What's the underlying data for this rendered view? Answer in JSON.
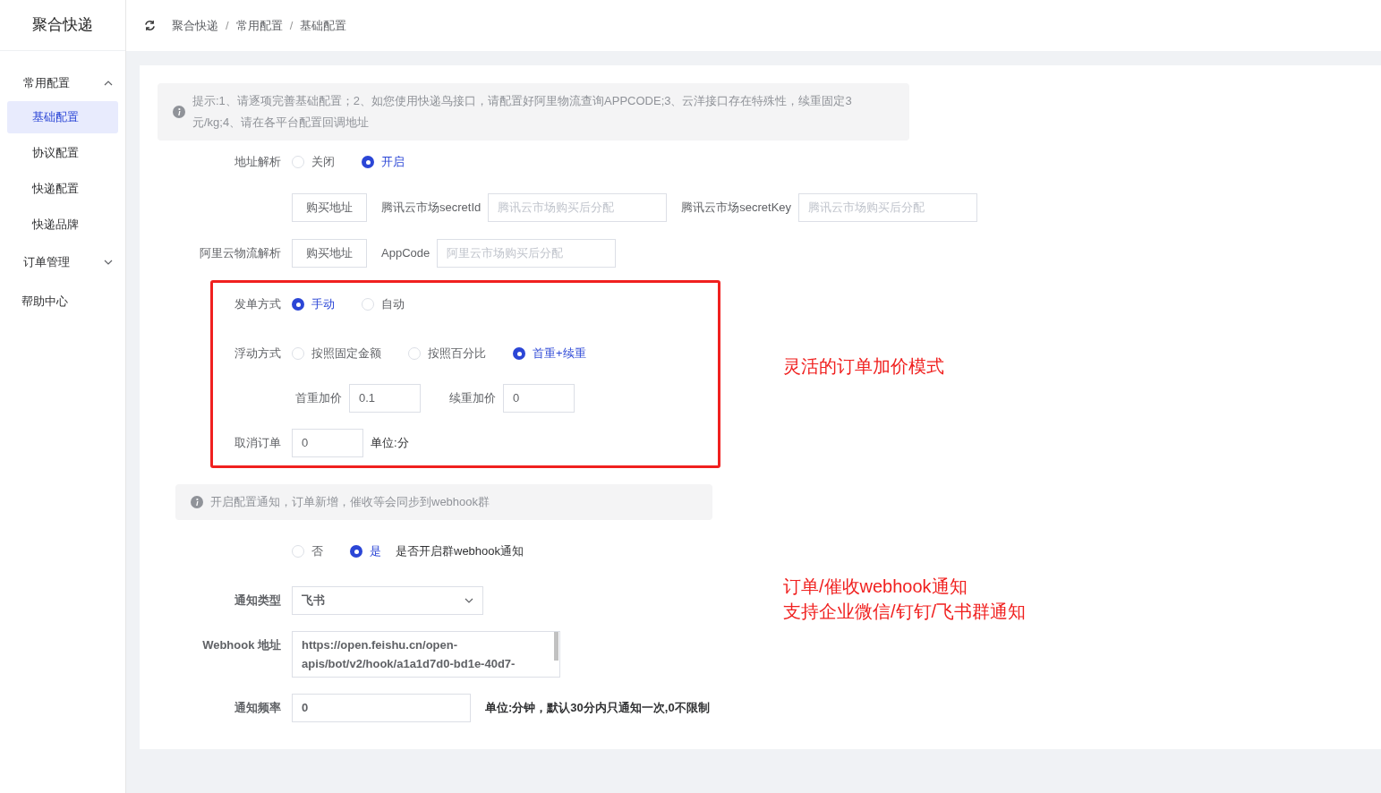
{
  "sidebar": {
    "logo": "聚合快递",
    "menu": [
      {
        "kind": "group",
        "label": "常用配置",
        "expanded": true,
        "children": [
          {
            "label": "基础配置",
            "selected": true
          },
          {
            "label": "协议配置",
            "selected": false
          },
          {
            "label": "快递配置",
            "selected": false
          },
          {
            "label": "快递品牌",
            "selected": false
          }
        ]
      },
      {
        "kind": "group",
        "label": "订单管理",
        "expanded": false
      },
      {
        "kind": "item",
        "label": "帮助中心"
      }
    ]
  },
  "header": {
    "breadcrumb": [
      "聚合快递",
      "常用配置",
      "基础配置"
    ],
    "separators": [
      "/",
      "/"
    ]
  },
  "notice": "提示:1、请逐项完善基础配置；2、如您使用快递鸟接口，请配置好阿里物流查询APPCODE;3、云洋接口存在特殊性，续重固定3元/kg;4、请在各平台配置回调地址",
  "address_parse": {
    "label": "地址解析",
    "options": [
      {
        "label": "关闭",
        "selected": false
      },
      {
        "label": "开启",
        "selected": true
      }
    ]
  },
  "tencent": {
    "button": "购买地址",
    "secret_id_label": "腾讯云市场secretId",
    "secret_id_placeholder": "腾讯云市场购买后分配",
    "secret_key_label": "腾讯云市场secretKey",
    "secret_key_placeholder": "腾讯云市场购买后分配"
  },
  "aliyun": {
    "label": "阿里云物流解析",
    "button": "购买地址",
    "appcode_label": "AppCode",
    "appcode_placeholder": "阿里云市场购买后分配"
  },
  "pricing": {
    "dispatch": {
      "label": "发单方式",
      "options": [
        {
          "label": "手动",
          "selected": true
        },
        {
          "label": "自动",
          "selected": false
        }
      ]
    },
    "float": {
      "label": "浮动方式",
      "options": [
        {
          "label": "按照固定金额",
          "selected": false
        },
        {
          "label": "按照百分比",
          "selected": false
        },
        {
          "label": "首重+续重",
          "selected": true
        }
      ]
    },
    "first_weight": {
      "label": "首重加价",
      "value": "0.1"
    },
    "additional_weight": {
      "label": "续重加价",
      "value": "0"
    },
    "cancel": {
      "label": "取消订单",
      "value": "0",
      "unit": "单位:分"
    }
  },
  "webhook_notice": "开启配置通知，订单新增，催收等会同步到webhook群",
  "webhook_toggle": {
    "options": [
      {
        "label": "否",
        "selected": false
      },
      {
        "label": "是",
        "selected": true
      }
    ],
    "description": "是否开启群webhook通知"
  },
  "notify_type": {
    "label": "通知类型",
    "value": "飞书"
  },
  "webhook_url": {
    "label": "Webhook 地址",
    "value": "https://open.feishu.cn/open-apis/bot/v2/hook/a1a1d7d0-bd1e-40d7-"
  },
  "frequency": {
    "label": "通知频率",
    "value": "0",
    "hint": "单位:分钟，默认30分内只通知一次,0不限制"
  },
  "annotations": [
    {
      "lines": [
        "灵活的订单加价模式"
      ]
    },
    {
      "lines": [
        "订单/催收webhook通知",
        "支持企业微信/钉钉/飞书群通知"
      ]
    }
  ]
}
